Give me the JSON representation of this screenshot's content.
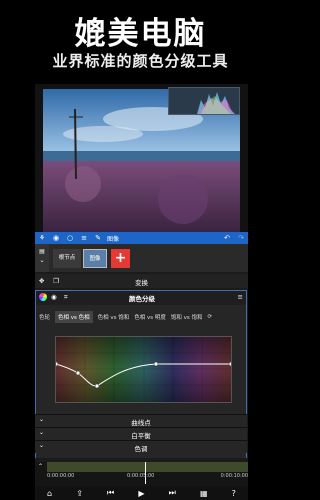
{
  "promo": {
    "headline": "媲美电脑",
    "subline": "业界标准的颜色分级工具"
  },
  "toolbar": {
    "icons": [
      "tree-icon",
      "eye-icon",
      "circle-icon",
      "menu-icon",
      "edit-icon"
    ],
    "label": "图像",
    "undo": "↶",
    "redo": "↷"
  },
  "tracks": {
    "side_top": "▤",
    "side_bottom": "⌄",
    "chip1": "根节点",
    "chip2": "图像",
    "add": "+"
  },
  "transform": {
    "label": "变换"
  },
  "panel": {
    "title": "颜色分级",
    "tabs": [
      "色轮",
      "色相 vs 色相",
      "色相 vs 饱和",
      "色相 vs 明度",
      "饱和 vs 饱和"
    ],
    "selected_tab": 1
  },
  "sections": [
    "曲线点",
    "白平衡",
    "色调"
  ],
  "timeline": {
    "times": [
      "0:00:00:00",
      "0:00:05:00",
      "0:00:10:00"
    ]
  },
  "colors": {
    "accent_blue": "#1d66c7",
    "add_red": "#e53935"
  }
}
